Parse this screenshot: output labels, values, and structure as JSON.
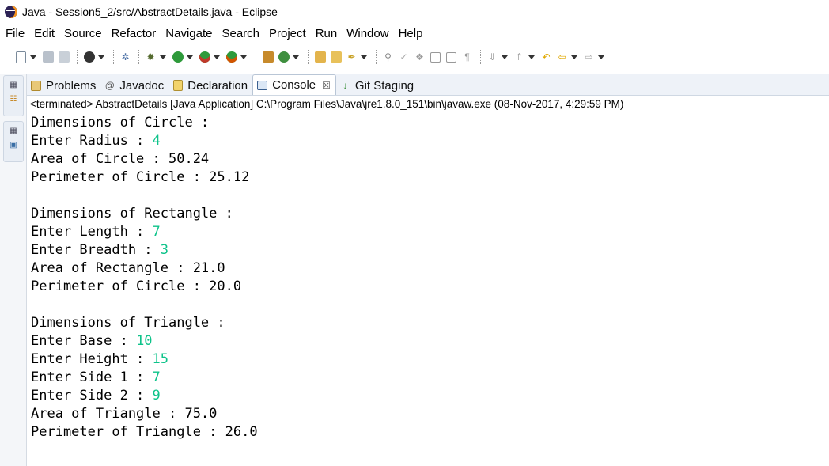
{
  "window": {
    "title": "Java - Session5_2/src/AbstractDetails.java - Eclipse",
    "icon": "eclipse-logo-icon"
  },
  "menu": [
    "File",
    "Edit",
    "Source",
    "Refactor",
    "Navigate",
    "Search",
    "Project",
    "Run",
    "Window",
    "Help"
  ],
  "toolbar_icons": [
    "new-icon",
    "save-icon",
    "save-all-icon",
    "debug-skip-icon",
    "skip-breakpoints-icon",
    "debug-icon",
    "run-icon",
    "coverage-icon",
    "external-tools-icon",
    "new-java-package-icon",
    "new-class-icon",
    "open-type-icon",
    "search-icon",
    "annotation-icon",
    "pin-icon",
    "toggle-mark-icon",
    "format-icon",
    "block-icon",
    "show-whitespace-icon",
    "next-annotation-icon",
    "prev-annotation-icon",
    "last-edit-icon",
    "back-icon",
    "forward-icon"
  ],
  "tabs": [
    {
      "label": "Problems",
      "icon": "problems-icon",
      "active": false
    },
    {
      "label": "Javadoc",
      "icon": "javadoc-icon",
      "active": false
    },
    {
      "label": "Declaration",
      "icon": "declaration-icon",
      "active": false
    },
    {
      "label": "Console",
      "icon": "console-icon",
      "active": true,
      "close": "☒"
    },
    {
      "label": "Git Staging",
      "icon": "git-staging-icon",
      "active": false
    }
  ],
  "console": {
    "status": "<terminated> AbstractDetails [Java Application] C:\\Program Files\\Java\\jre1.8.0_151\\bin\\javaw.exe (08-Nov-2017, 4:29:59 PM)",
    "input_color": "#0ec38a",
    "lines": [
      {
        "text": "Dimensions of Circle :",
        "input": ""
      },
      {
        "text": "Enter Radius : ",
        "input": "4"
      },
      {
        "text": "Area of Circle : 50.24",
        "input": ""
      },
      {
        "text": "Perimeter of Circle : 25.12",
        "input": ""
      },
      {
        "text": "",
        "input": ""
      },
      {
        "text": "Dimensions of Rectangle :",
        "input": ""
      },
      {
        "text": "Enter Length : ",
        "input": "7"
      },
      {
        "text": "Enter Breadth : ",
        "input": "3"
      },
      {
        "text": "Area of Rectangle : 21.0",
        "input": ""
      },
      {
        "text": "Perimeter of Circle : 20.0",
        "input": ""
      },
      {
        "text": "",
        "input": ""
      },
      {
        "text": "Dimensions of Triangle :",
        "input": ""
      },
      {
        "text": "Enter Base : ",
        "input": "10"
      },
      {
        "text": "Enter Height : ",
        "input": "15"
      },
      {
        "text": "Enter Side 1 : ",
        "input": "7"
      },
      {
        "text": "Enter Side 2 : ",
        "input": "9"
      },
      {
        "text": "Area of Triangle : 75.0",
        "input": ""
      },
      {
        "text": "Perimeter of Triangle : 26.0",
        "input": ""
      }
    ]
  }
}
